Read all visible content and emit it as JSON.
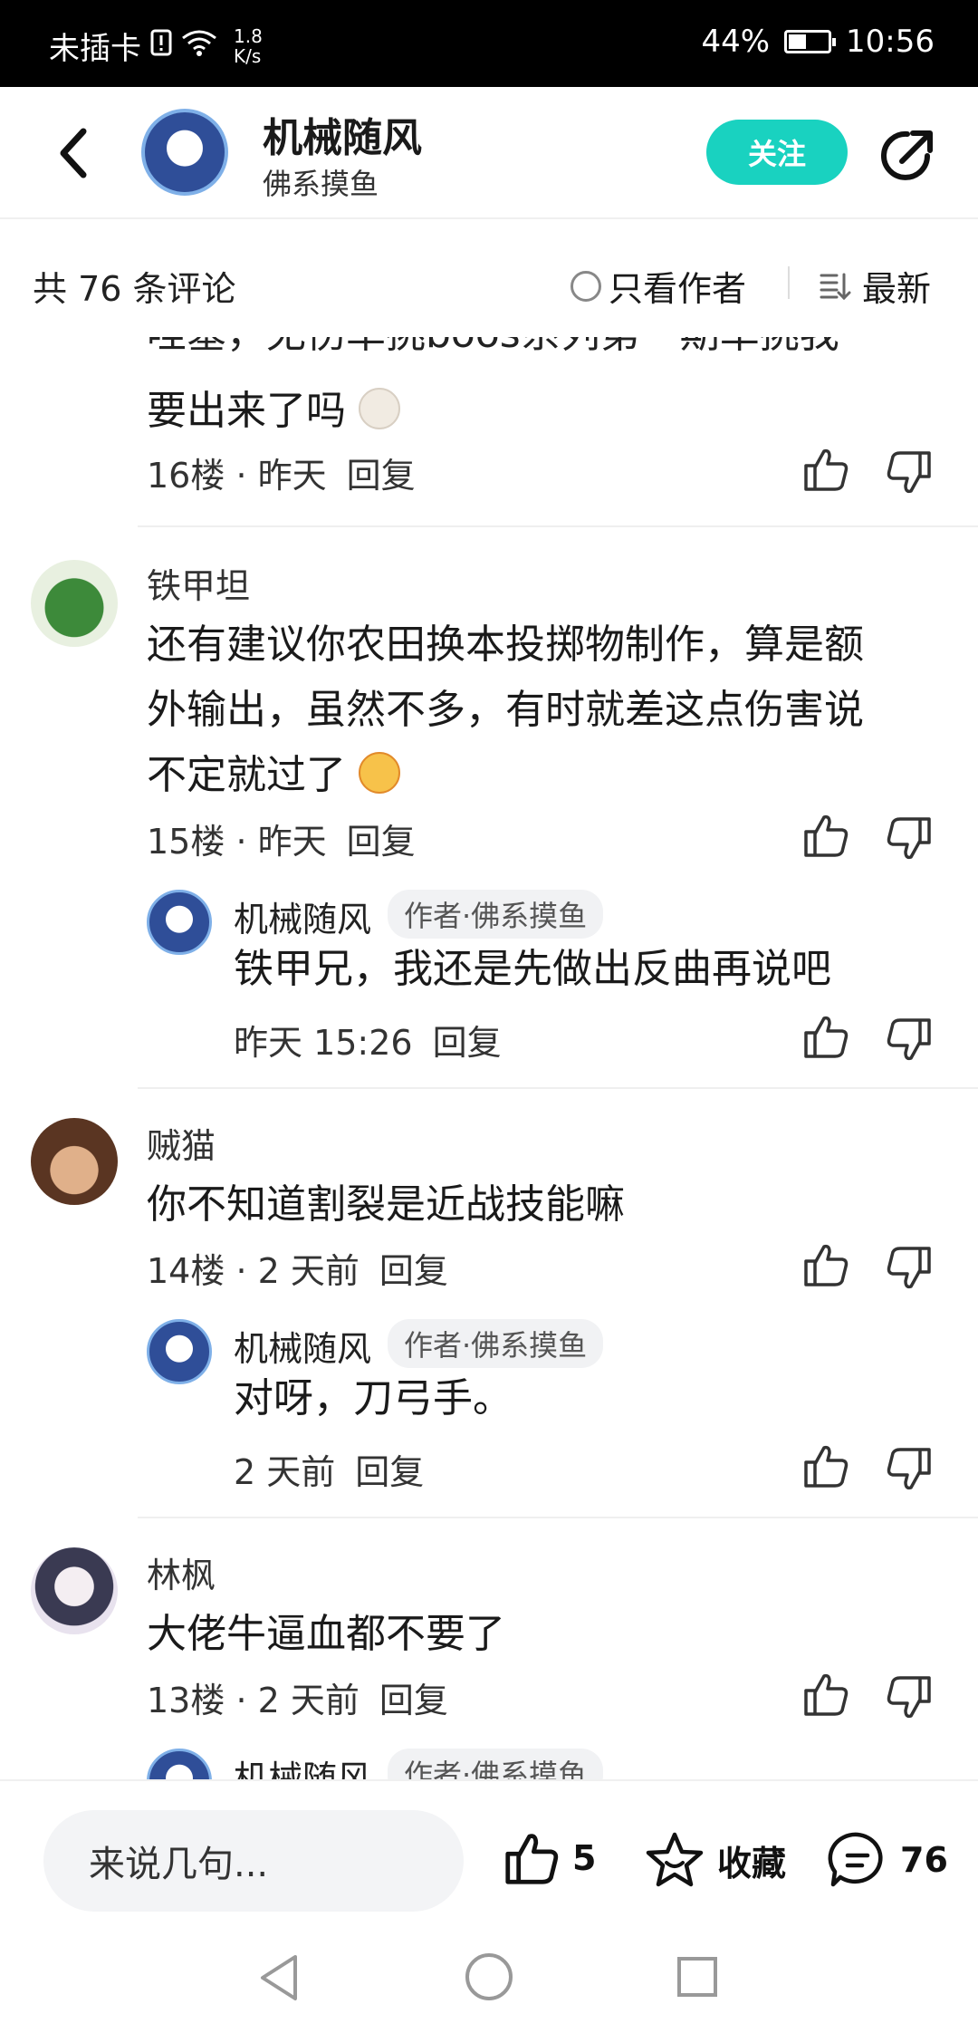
{
  "status": {
    "carrier": "未插卡",
    "speed_value": "1.8",
    "speed_unit": "K/s",
    "battery": "44%",
    "time": "10:56",
    "battery_level": 0.44
  },
  "header": {
    "author_name": "机械随风",
    "author_subtitle": "佛系摸鱼",
    "follow_label": "关注"
  },
  "filter": {
    "count_label": "共 76 条评论",
    "only_author_label": "只看作者",
    "sort_label": "最新"
  },
  "comments": {
    "partial": {
      "text_cut": "哇塞，无伤单挑boos系列第一期单挑我",
      "text": "要出来了吗",
      "floor": "16楼",
      "time": "昨天",
      "reply": "回复"
    },
    "c15": {
      "name": "铁甲坦",
      "line1": "还有建议你农田换本投掷物制作，算是额",
      "line2": "外输出，虽然不多，有时就差这点伤害说",
      "line3": "不定就过了",
      "floor": "15楼",
      "time": "昨天",
      "reply": "回复",
      "sub": {
        "name": "机械随风",
        "tag": "作者·佛系摸鱼",
        "text": "铁甲兄，我还是先做出反曲再说吧",
        "time": "昨天 15:26",
        "reply": "回复"
      }
    },
    "c14": {
      "name": "贼猫",
      "text": "你不知道割裂是近战技能嘛",
      "floor": "14楼",
      "time": "2 天前",
      "reply": "回复",
      "sub": {
        "name": "机械随风",
        "tag": "作者·佛系摸鱼",
        "text": "对呀，刀弓手。",
        "time": "2 天前",
        "reply": "回复"
      }
    },
    "c13": {
      "name": "林枫",
      "text": "大佬牛逼血都不要了",
      "floor": "13楼",
      "time": "2 天前",
      "reply": "回复",
      "sub": {
        "name": "机械随风",
        "tag": "作者·佛系摸鱼"
      }
    }
  },
  "bottom": {
    "input_placeholder": "来说几句...",
    "like_count": "5",
    "favorite_label": "收藏",
    "comment_count": "76"
  },
  "colors": {
    "accent": "#19d2c0",
    "status_bar": "#000000"
  },
  "icons": [
    "back-icon",
    "share-icon",
    "radio-icon",
    "sort-icon",
    "thumb-up-icon",
    "thumb-down-icon",
    "star-icon",
    "comment-icon",
    "nav-back-icon",
    "nav-home-icon",
    "nav-recent-icon"
  ]
}
